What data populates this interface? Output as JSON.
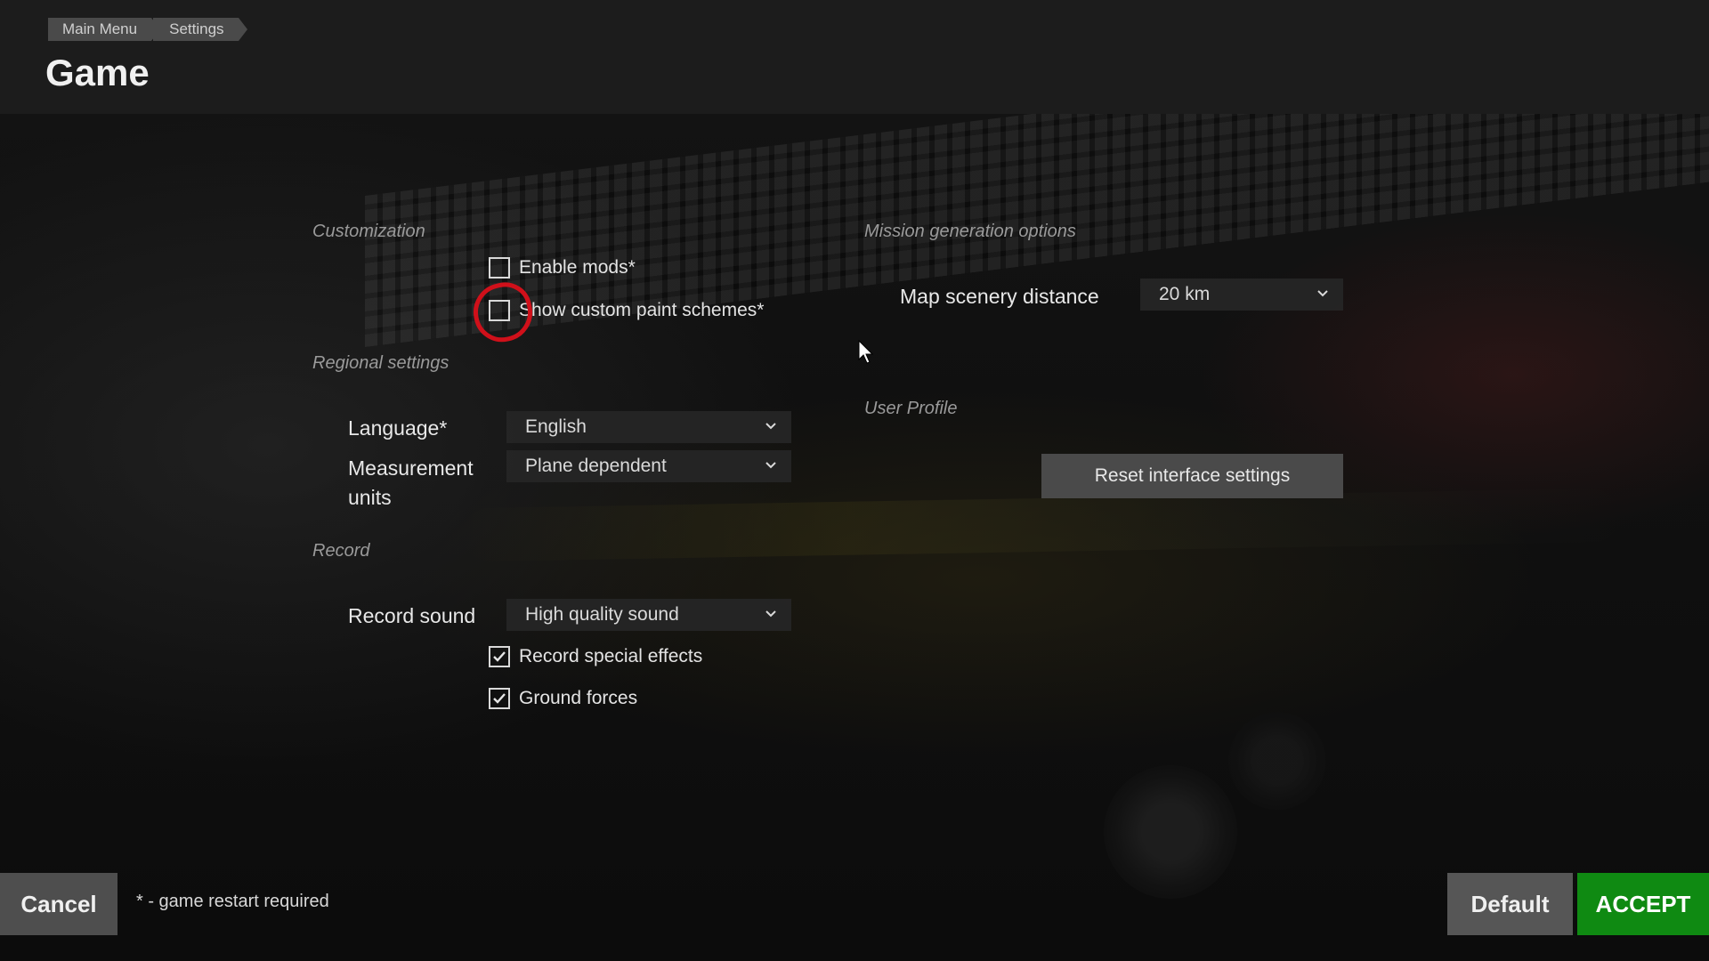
{
  "breadcrumb": [
    "Main Menu",
    "Settings"
  ],
  "page_title": "Game",
  "customization": {
    "title": "Customization",
    "enable_mods": {
      "label": "Enable mods*",
      "checked": false
    },
    "custom_paint": {
      "label": "Show custom paint schemes*",
      "checked": false
    }
  },
  "regional": {
    "title": "Regional settings",
    "language": {
      "label": "Language*",
      "value": "English"
    },
    "units": {
      "label_line1": "Measurement",
      "label_line2": "units",
      "value": "Plane dependent"
    }
  },
  "record": {
    "title": "Record",
    "sound": {
      "label": "Record sound",
      "value": "High quality sound"
    },
    "special_effects": {
      "label": "Record special effects",
      "checked": true
    },
    "ground_forces": {
      "label": "Ground forces",
      "checked": true
    }
  },
  "mission": {
    "title": "Mission generation options",
    "scenery_distance": {
      "label": "Map scenery distance",
      "value": "20 km"
    }
  },
  "profile": {
    "title": "User Profile",
    "reset_label": "Reset interface settings"
  },
  "footer": {
    "cancel_label": "Cancel",
    "note": "* - game restart required",
    "default_label": "Default",
    "accept_label": "ACCEPT"
  },
  "colors": {
    "accept": "#0f8a12",
    "annotation": "#d0101a"
  }
}
